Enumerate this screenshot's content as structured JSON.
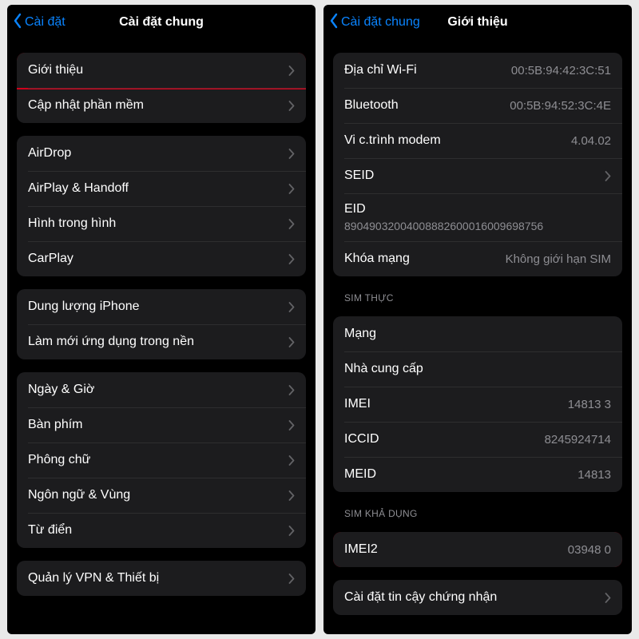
{
  "colors": {
    "accent": "#0a84ff",
    "highlight": "#d0021b"
  },
  "left": {
    "back_label": "Cài đặt",
    "title": "Cài đặt chung",
    "groups": [
      {
        "rows": [
          {
            "key": "about",
            "label": "Giới thiệu",
            "chevron": true,
            "highlight": true
          },
          {
            "key": "software-update",
            "label": "Cập nhật phần mềm",
            "chevron": true
          }
        ]
      },
      {
        "rows": [
          {
            "key": "airdrop",
            "label": "AirDrop",
            "chevron": true
          },
          {
            "key": "airplay",
            "label": "AirPlay & Handoff",
            "chevron": true
          },
          {
            "key": "pip",
            "label": "Hình trong hình",
            "chevron": true
          },
          {
            "key": "carplay",
            "label": "CarPlay",
            "chevron": true
          }
        ]
      },
      {
        "rows": [
          {
            "key": "storage",
            "label": "Dung lượng iPhone",
            "chevron": true
          },
          {
            "key": "bg-refresh",
            "label": "Làm mới ứng dụng trong nền",
            "chevron": true
          }
        ]
      },
      {
        "rows": [
          {
            "key": "date",
            "label": "Ngày & Giờ",
            "chevron": true
          },
          {
            "key": "keyboard",
            "label": "Bàn phím",
            "chevron": true
          },
          {
            "key": "fonts",
            "label": "Phông chữ",
            "chevron": true
          },
          {
            "key": "lang",
            "label": "Ngôn ngữ & Vùng",
            "chevron": true
          },
          {
            "key": "dict",
            "label": "Từ điển",
            "chevron": true
          }
        ]
      },
      {
        "rows": [
          {
            "key": "vpn",
            "label": "Quản lý VPN & Thiết bị",
            "chevron": true
          }
        ]
      }
    ]
  },
  "right": {
    "back_label": "Cài đặt chung",
    "title": "Giới thiệu",
    "groups": [
      {
        "rows": [
          {
            "key": "wifi",
            "label": "Địa chỉ Wi-Fi",
            "value": "00:5B:94:42:3C:51"
          },
          {
            "key": "bt",
            "label": "Bluetooth",
            "value": "00:5B:94:52:3C:4E"
          },
          {
            "key": "modem",
            "label": "Vi c.trình modem",
            "value": "4.04.02"
          },
          {
            "key": "seid",
            "label": "SEID",
            "chevron": true
          },
          {
            "key": "eid",
            "label": "EID",
            "sub": "89049032004008882600016009698756",
            "stack": true
          },
          {
            "key": "lock",
            "label": "Khóa mạng",
            "value": "Không giới hạn SIM"
          }
        ]
      },
      {
        "header": "SIM THỰC",
        "rows": [
          {
            "key": "network",
            "label": "Mạng",
            "value": ""
          },
          {
            "key": "carrier",
            "label": "Nhà cung cấp",
            "value": ""
          },
          {
            "key": "imei",
            "label": "IMEI",
            "value": "14813 3"
          },
          {
            "key": "iccid",
            "label": "ICCID",
            "value": "8245924714"
          },
          {
            "key": "meid",
            "label": "MEID",
            "value": "14813"
          }
        ]
      },
      {
        "header": "SIM KHẢ DỤNG",
        "rows": [
          {
            "key": "imei2",
            "label": "IMEI2",
            "value": "03948 0",
            "highlight": true
          }
        ]
      },
      {
        "rows": [
          {
            "key": "cert",
            "label": "Cài đặt tin cậy chứng nhận",
            "chevron": true
          }
        ]
      }
    ]
  }
}
